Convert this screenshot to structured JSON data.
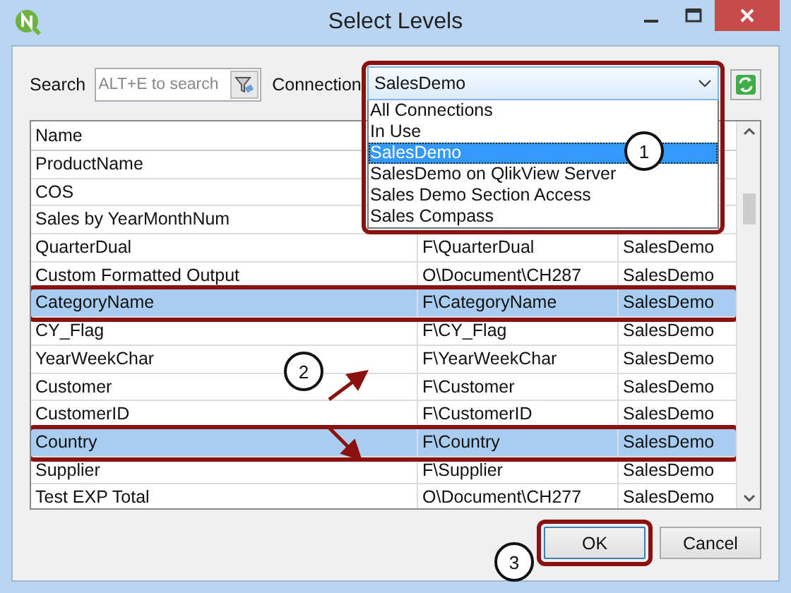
{
  "window": {
    "title": "Select Levels"
  },
  "search": {
    "label": "Search",
    "placeholder": "ALT+E to search"
  },
  "connection": {
    "label": "Connection",
    "value": "SalesDemo",
    "expanded": true,
    "annotated": true,
    "options": [
      {
        "label": "All Connections",
        "selected": false
      },
      {
        "label": "In Use",
        "selected": false
      },
      {
        "label": "SalesDemo",
        "selected": true
      },
      {
        "label": "SalesDemo on QlikView Server",
        "selected": false
      },
      {
        "label": "Sales Demo Section Access",
        "selected": false
      },
      {
        "label": "Sales Compass",
        "selected": false
      }
    ]
  },
  "table": {
    "columns": [
      "Name"
    ],
    "rows": [
      {
        "name": "ProductName",
        "selected": false,
        "annotated": false
      },
      {
        "name": "COS",
        "selected": false,
        "annotated": false
      },
      {
        "name": "Sales by YearMonthNum",
        "selected": false,
        "annotated": false
      },
      {
        "name": "QuarterDual",
        "path": "F\\QuarterDual",
        "connection": "SalesDemo",
        "selected": false,
        "annotated": false
      },
      {
        "name": "Custom Formatted Output",
        "path": "O\\Document\\CH287",
        "connection": "SalesDemo",
        "selected": false,
        "annotated": false
      },
      {
        "name": "CategoryName",
        "path": "F\\CategoryName",
        "connection": "SalesDemo",
        "selected": true,
        "annotated": true
      },
      {
        "name": "CY_Flag",
        "path": "F\\CY_Flag",
        "connection": "SalesDemo",
        "selected": false,
        "annotated": false
      },
      {
        "name": "YearWeekChar",
        "path": "F\\YearWeekChar",
        "connection": "SalesDemo",
        "selected": false,
        "annotated": false
      },
      {
        "name": "Customer",
        "path": "F\\Customer",
        "connection": "SalesDemo",
        "selected": false,
        "annotated": false
      },
      {
        "name": "CustomerID",
        "path": "F\\CustomerID",
        "connection": "SalesDemo",
        "selected": false,
        "annotated": false
      },
      {
        "name": "Country",
        "path": "F\\Country",
        "connection": "SalesDemo",
        "selected": true,
        "annotated": true
      },
      {
        "name": "Supplier",
        "path": "F\\Supplier",
        "connection": "SalesDemo",
        "selected": false,
        "annotated": false
      },
      {
        "name": "Test EXP Total",
        "path": "O\\Document\\CH277",
        "connection": "SalesDemo",
        "selected": false,
        "annotated": false
      }
    ]
  },
  "buttons": [
    {
      "label": "OK",
      "annotated": true
    },
    {
      "label": "Cancel",
      "annotated": false
    }
  ],
  "callouts": [
    {
      "label": "1"
    },
    {
      "label": "2"
    },
    {
      "label": "3"
    }
  ]
}
